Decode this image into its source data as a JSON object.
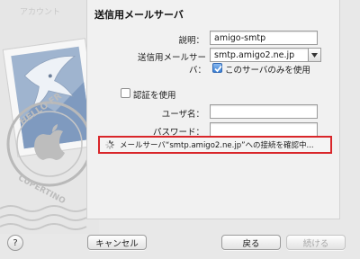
{
  "background_hint": "アカウント",
  "panel": {
    "title": "送信用メールサーバ"
  },
  "form": {
    "description_label": "説明：",
    "description_value": "amigo-smtp",
    "smtp_server_label": "送信用メールサーバ：",
    "smtp_server_value": "smtp.amigo2.ne.jp",
    "use_only_this_server_label": "このサーバのみを使用",
    "use_only_this_server_checked": true,
    "use_auth_label": "認証を使用",
    "use_auth_checked": false,
    "username_label": "ユーザ名：",
    "username_value": "",
    "password_label": "パスワード：",
    "password_value": ""
  },
  "status": {
    "message": "メールサーバ“smtp.amigo2.ne.jp”への接続を確認中..."
  },
  "buttons": {
    "cancel": "キャンセル",
    "back": "戻る",
    "continue": "続ける"
  },
  "icons": {
    "help": "?",
    "spinner": "spinner-icon",
    "stamp": "mail-stamp-icon"
  },
  "stamp_text": {
    "top": "HELLO FR",
    "bottom": "CUPERTINO"
  },
  "colors": {
    "highlight_border": "#d9262a",
    "checkbox_checked": "#3a7fd4"
  }
}
